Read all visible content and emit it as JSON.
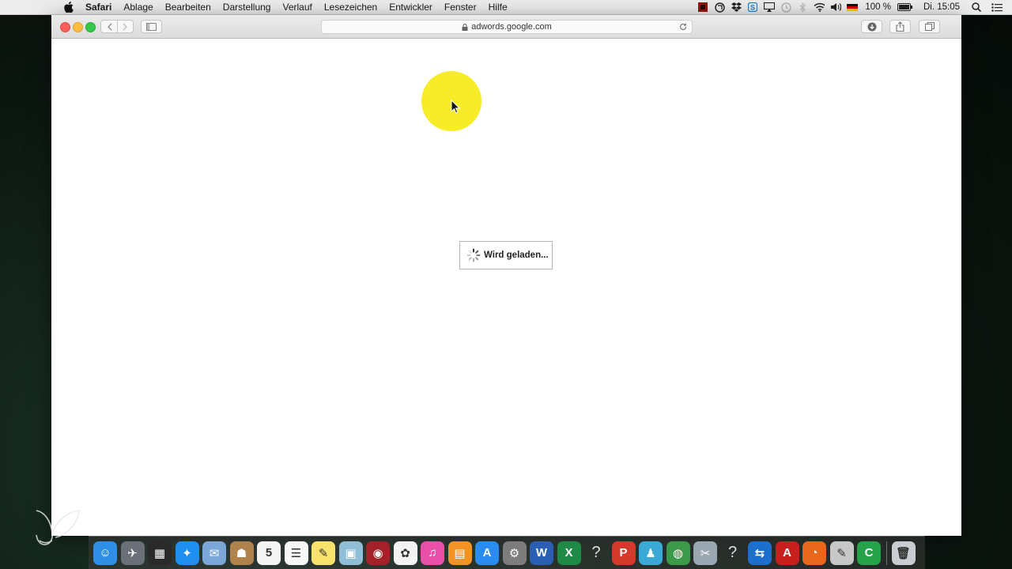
{
  "menubar": {
    "app_name": "Safari",
    "items": [
      "Ablage",
      "Bearbeiten",
      "Darstellung",
      "Verlauf",
      "Lesezeichen",
      "Entwickler",
      "Fenster",
      "Hilfe"
    ],
    "battery": "100 %",
    "clock": "Di. 15:05",
    "status_icons": [
      "screen-record-icon",
      "stamp-icon",
      "dropbox-icon",
      "skype-icon",
      "airplay-icon",
      "time-machine-icon",
      "bluetooth-icon",
      "wifi-icon",
      "volume-icon",
      "german-flag-icon",
      "battery-icon",
      "spotlight-icon",
      "notification-center-icon"
    ]
  },
  "browser": {
    "url": "adwords.google.com",
    "loading_text": "Wird geladen..."
  },
  "dock": {
    "apps": [
      {
        "name": "finder",
        "glyph": "☺",
        "color": "#2f8ee6"
      },
      {
        "name": "launchpad",
        "glyph": "✈",
        "color": "#6a6f78"
      },
      {
        "name": "mission-control",
        "glyph": "▦",
        "color": "#2a2a2a"
      },
      {
        "name": "safari",
        "glyph": "✦",
        "color": "#1f8ef1"
      },
      {
        "name": "mail",
        "glyph": "✉",
        "color": "#7aa7d8"
      },
      {
        "name": "contacts",
        "glyph": "☗",
        "color": "#b0834d"
      },
      {
        "name": "calendar",
        "glyph": "5",
        "color": "#f4f4f4"
      },
      {
        "name": "reminders",
        "glyph": "☰",
        "color": "#f7f7f7"
      },
      {
        "name": "notes",
        "glyph": "✎",
        "color": "#f7e26b"
      },
      {
        "name": "preview",
        "glyph": "▣",
        "color": "#8fbfd8"
      },
      {
        "name": "photo-booth",
        "glyph": "◉",
        "color": "#a3222a"
      },
      {
        "name": "photos",
        "glyph": "✿",
        "color": "#f3f3f3"
      },
      {
        "name": "itunes",
        "glyph": "♫",
        "color": "#e94fa8"
      },
      {
        "name": "ibooks",
        "glyph": "▤",
        "color": "#f39325"
      },
      {
        "name": "app-store",
        "glyph": "A",
        "color": "#2a8cf0"
      },
      {
        "name": "system-preferences",
        "glyph": "⚙",
        "color": "#7d7d7d"
      },
      {
        "name": "word",
        "glyph": "W",
        "color": "#2b5fb4"
      },
      {
        "name": "excel",
        "glyph": "X",
        "color": "#1e8a45"
      },
      {
        "name": "unknown-app-1",
        "glyph": "?",
        "color": "transparent"
      },
      {
        "name": "powerpoint-red",
        "glyph": "P",
        "color": "#d33a2c"
      },
      {
        "name": "lync",
        "glyph": "♟",
        "color": "#3aa9d6"
      },
      {
        "name": "network-globe",
        "glyph": "◍",
        "color": "#3a9a4a"
      },
      {
        "name": "utility-tool",
        "glyph": "✂",
        "color": "#9aa6b0"
      },
      {
        "name": "unknown-app-2",
        "glyph": "?",
        "color": "transparent"
      },
      {
        "name": "teamviewer",
        "glyph": "⇆",
        "color": "#1c6fcf"
      },
      {
        "name": "acrobat",
        "glyph": "A",
        "color": "#c8201d"
      },
      {
        "name": "firefox",
        "glyph": "◔",
        "color": "#e8671c"
      },
      {
        "name": "script-editor",
        "glyph": "✎",
        "color": "#c7c7c7"
      },
      {
        "name": "camtasia",
        "glyph": "C",
        "color": "#25a24a"
      }
    ],
    "trash": {
      "name": "trash",
      "glyph": "🗑",
      "color": "#c9cdd1"
    }
  },
  "colors": {
    "cursor_highlight": "#f6ec1c",
    "close": "#fc605c",
    "minimize": "#fdbc40",
    "zoom": "#34c84a"
  }
}
